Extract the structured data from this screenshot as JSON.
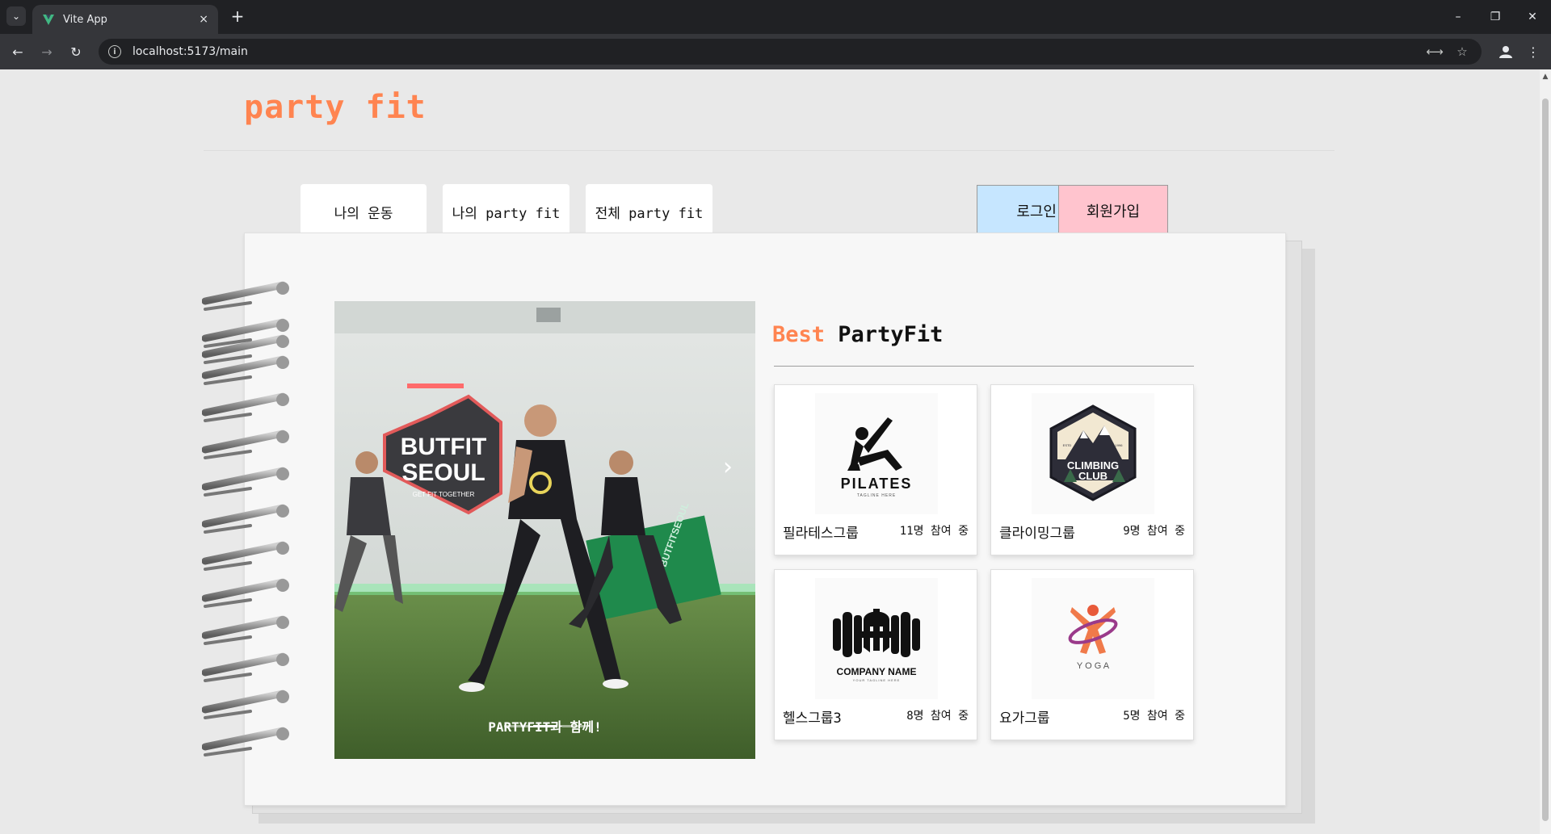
{
  "browser": {
    "tab_title": "Vite App",
    "tab_close": "×",
    "new_tab": "+",
    "url": "localhost:5173/main",
    "window_controls": [
      "–",
      "❐",
      "✕"
    ]
  },
  "page": {
    "logo": "party fit",
    "nav_tabs": [
      "나의 운동",
      "나의 party fit",
      "전체 party fit"
    ],
    "login_label": "로그인",
    "signup_label": "회원가입",
    "carousel": {
      "caption": "PARTYFIT과 함께!",
      "slide_count": 3,
      "active_slide": 2,
      "image_texts": [
        "BUTFIT",
        "SEOUL",
        "GET FIT TOGETHER",
        "BUTFITSEOUL"
      ]
    },
    "best": {
      "accent": "Best",
      "title": "PartyFit",
      "cards": [
        {
          "name": "필라테스그룹",
          "count": "11명 참여 중",
          "logo_text": "PILATES",
          "logo_sub": "TAGLINE HERE",
          "icon": "pilates-figure-icon"
        },
        {
          "name": "클라이밍그룹",
          "count": "9명 참여 중",
          "logo_text": "CLIMBING",
          "logo_text2": "CLUB",
          "logo_est": "ESTD",
          "logo_year": "1996",
          "icon": "mountain-badge-icon"
        },
        {
          "name": "헬스그룹3",
          "count": "8명 참여 중",
          "logo_text": "COMPANY NAME",
          "logo_sub": "YOUR TAGLINE HERE",
          "icon": "dumbbell-icon"
        },
        {
          "name": "요가그룹",
          "count": "5명 참여 중",
          "logo_text": "Y O G A",
          "icon": "yoga-figure-icon"
        }
      ]
    }
  },
  "colors": {
    "accent": "#ff8450",
    "login_bg": "#c6e6ff",
    "signup_bg": "#ffc4ce"
  }
}
